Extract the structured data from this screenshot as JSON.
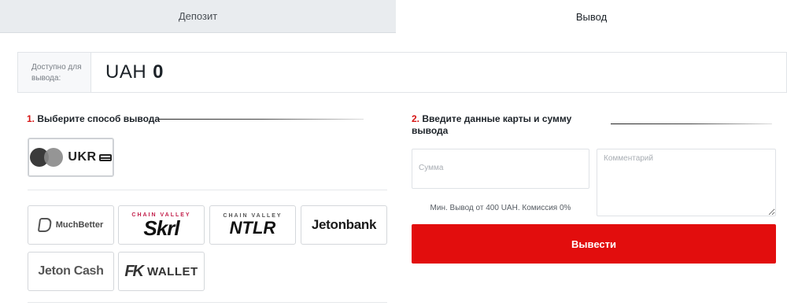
{
  "tabs": [
    {
      "label": "Депозит",
      "active": false
    },
    {
      "label": "Вывод",
      "active": true
    }
  ],
  "balance": {
    "label": "Доступно для вывода:",
    "currency": "UAH",
    "amount": "0"
  },
  "step1": {
    "number": "1.",
    "title": "Выберите способ вывода"
  },
  "step2": {
    "number": "2.",
    "title_line1": "Введите данные карты и сумму",
    "title_line2": "вывода"
  },
  "methods": {
    "ukr": {
      "text": "UKR",
      "icon": "mastercard-circles-icon"
    },
    "muchbetter": {
      "text": "MuchBetter",
      "icon": "muchbetter-icon"
    },
    "skrl": {
      "top": "CHAIN VALLEY",
      "text": "Skrl",
      "top_color": "#c21f4a"
    },
    "ntlr": {
      "top": "CHAIN VALLEY",
      "text": "NTLR",
      "top_color": "#555555"
    },
    "jetonbank": {
      "text": "Jetonbank"
    },
    "jetoncash": {
      "text": "Jeton Cash"
    },
    "fkwallet": {
      "mark": "FK",
      "text": "WALLET"
    }
  },
  "form": {
    "amount_placeholder": "Сумма",
    "comment_placeholder": "Комментарий",
    "hint": "Мин. Вывод от 400 UAH. Комиссия 0%",
    "submit_label": "Вывести"
  },
  "colors": {
    "accent": "#e20d0d",
    "tab_inactive_bg": "#e9ecef"
  }
}
